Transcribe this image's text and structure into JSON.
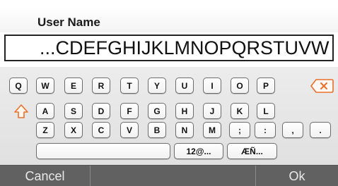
{
  "field": {
    "label": "User Name",
    "value": "...CDEFGHIJKLMNOPQRSTUVW"
  },
  "keyboard": {
    "rows": [
      [
        "Q",
        "W",
        "E",
        "R",
        "T",
        "Y",
        "U",
        "I",
        "O",
        "P"
      ],
      [
        "A",
        "S",
        "D",
        "F",
        "G",
        "H",
        "J",
        "K",
        "L"
      ],
      [
        "Z",
        "X",
        "C",
        "V",
        "B",
        "N",
        "M",
        ";",
        ":",
        ",",
        "."
      ]
    ],
    "symbols_label": "12@...",
    "accents_label": "ÆÑ...",
    "space_label": "",
    "icons": {
      "shift": "shift-arrow-icon",
      "backspace": "backspace-icon"
    },
    "colors": {
      "accent": "#e8702a",
      "key_border": "#6c6c6c"
    }
  },
  "footer": {
    "cancel": "Cancel",
    "ok": "Ok"
  }
}
